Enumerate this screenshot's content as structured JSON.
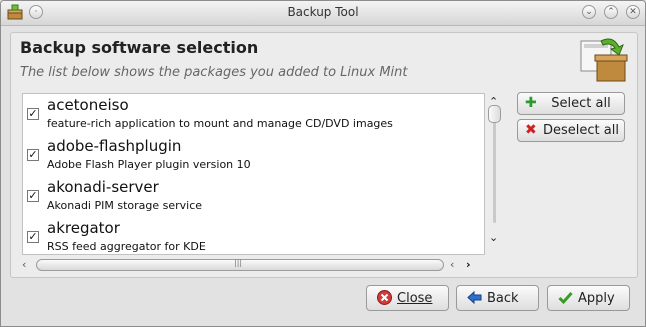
{
  "window": {
    "title": "Backup Tool",
    "app_icon": "package-box-icon",
    "controls": [
      "minimize-icon",
      "maximize-icon",
      "close-icon"
    ]
  },
  "header": {
    "title": "Backup software selection",
    "subtitle": "The list below shows the packages you added to Linux Mint",
    "icon": "package-box-icon"
  },
  "packages": [
    {
      "name": "acetoneiso",
      "description": "feature-rich application to mount and manage CD/DVD images",
      "checked": true
    },
    {
      "name": "adobe-flashplugin",
      "description": "Adobe Flash Player plugin version 10",
      "checked": true
    },
    {
      "name": "akonadi-server",
      "description": "Akonadi PIM storage service",
      "checked": true
    },
    {
      "name": "akregator",
      "description": "RSS feed aggregator for KDE",
      "checked": true
    }
  ],
  "side_buttons": {
    "select_all": "Select all",
    "deselect_all": "Deselect all"
  },
  "buttons": {
    "close": "Close",
    "back": "Back",
    "apply": "Apply"
  },
  "colors": {
    "select_icon": "#2e9a2e",
    "deselect_icon": "#cc2222",
    "back_icon": "#2f6fd0",
    "apply_icon": "#3a9a2a"
  }
}
